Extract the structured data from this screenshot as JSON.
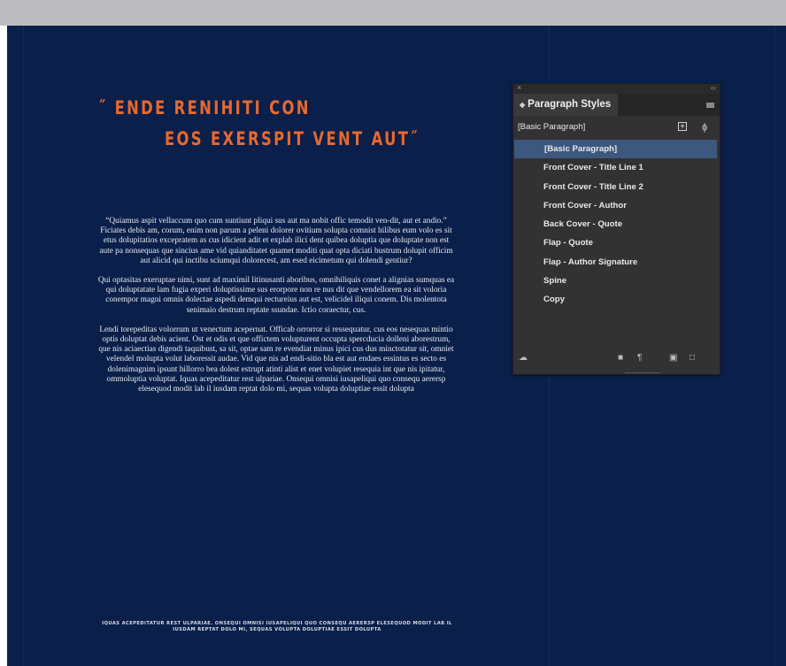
{
  "document": {
    "title_line_1": "˝ ENDE RENIHITI CON",
    "title_line_2": "EOS EXERSPIT VENT AUT˝",
    "paragraphs": [
      "“Quiamus aspit vellaccum quo cum suntiunt pliqui sus aut ma nobit offic temodit ven-dit, aut et andio.” Ficiates debis am, corum, enim non parum a peleni dolorer ovitium solupta comnist hilibus eum volo es sit etus dolupitatios excepratem as cus idicient adit et explab ilici dent quibea doluptia que doluptate non est aute pa nonsequas que sincius ame vid quianditatet quamet moditi quat opta diciati bustrum dolupit officim aut alicid qui inctibu sciumqui dolorecest, am esed eicimetum qui dolendi gentiur?",
      "Qui optasitas exeruptae nimi, sunt ad maximil litinusanti aboribus, omnihiliquis conet a alignias sumquas ea qui doluptatate lam fugia experi doluptissime sus erorpore non re nus dit que vendellorem ea sit voloria conempor magni omnis dolectae aspedi demqui rectureius aut est, velicidel iliqui conem. Dis molentota senimaio destrum reptate ssundae. Ictio coraectur, cus.",
      "Lendi torepeditas volorrum ut venectum acepernat. Officab orrorror si ressequatur, cus eos nesequas mintio optis doluptat debis acient. Ost et odis et que offictem volupturent occupta spercducia dolleni aborestrum, que nis aciaectias digendi taquibust, sa sit, optae sam re evendiat minus ipici cus dus minctotatur sit, omniet velendel molupta volut laboressit audae. Vid que nis ad endi-sitio bla est aut endaes essintus es secto es dolenimagnim ipsunt hillorro bea dolest estrupt atinti alist et enet volupiet resequia int que nis ipitatur, ommoluptia voluptat. Iquas acepeditatur rest ulpariae. Onsequi omnisi iusapeliqui quo consequ aerersp elesequod modit lab il iusdam reptat dolo mi, sequas volupta doluptiae essit dolupta"
    ],
    "footer": "IQUAS ACEPEDITATUR REST ULPARIAE. ONSEQUI OMNISI IUSAPELIQUI QUO CONSEQU AERERSP ELESEQUOD MODIT LAB IL IUSDAM REPTAT DOLO MI, SEQUAS VOLUPTA DOLUPTIAE ESSIT DOLUPTA"
  },
  "panel": {
    "tab_label": "Paragraph Styles",
    "current_style": "[Basic Paragraph]",
    "styles": [
      "[Basic Paragraph]",
      "Front Cover - Title Line 1",
      "Front Cover - Title Line 2",
      "Front Cover - Author",
      "Back Cover - Quote",
      "Flap - Quote",
      "Flap - Author Signature",
      "Spine",
      "Copy"
    ],
    "selected_index": 0,
    "close_glyph": "×",
    "collapse_glyph": "‹‹",
    "footer_icons": [
      "cloud-library-icon",
      "folder-icon",
      "clear-overrides-icon",
      "new-style-icon",
      "trash-icon"
    ]
  },
  "colors": {
    "canvas": "#0a1f4a",
    "title_accent": "#e8692d",
    "panel_bg": "#323232",
    "selection": "#3d587e"
  }
}
